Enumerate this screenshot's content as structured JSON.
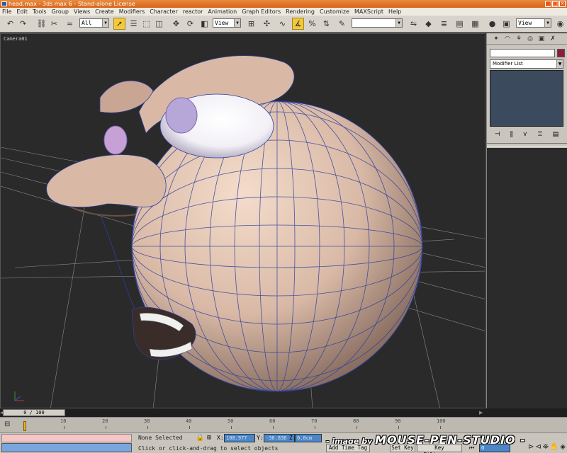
{
  "window": {
    "title": "head.max - 3ds max 6 - Stand-alone License"
  },
  "menu": [
    "File",
    "Edit",
    "Tools",
    "Group",
    "Views",
    "Create",
    "Modifiers",
    "Character",
    "reactor",
    "Animation",
    "Graph Editors",
    "Rendering",
    "Customize",
    "MAXScript",
    "Help"
  ],
  "toolbar": {
    "selection_filter": "All",
    "ref_coord": "View",
    "selection_set": "",
    "view_right": "View"
  },
  "viewport": {
    "label": "Camera01"
  },
  "command_panel": {
    "name_value": "",
    "modifier_list": "Modifier List",
    "swatch_color": "#8c1c3c"
  },
  "time": {
    "slider_label": "0 / 100",
    "ruler_ticks": [
      "10",
      "20",
      "30",
      "40",
      "50",
      "60",
      "70",
      "80",
      "90",
      "100"
    ]
  },
  "status": {
    "selection": "None Selected",
    "prompt": "Click or click-and-drag to select objects",
    "coord_x_label": "X:",
    "coord_x": "108.977",
    "coord_y_label": "Y:",
    "coord_y": "-36.836",
    "coord_z_label": "Z:",
    "coord_z": "0.0cm",
    "add_time_tag": "Add Time Tag",
    "set_key": "Set Key",
    "key_filters": "Key Filters...",
    "frame": "0"
  },
  "watermark": {
    "prefix": "- image by ",
    "brand": "MOUSE-PEN-STUDIO -"
  }
}
